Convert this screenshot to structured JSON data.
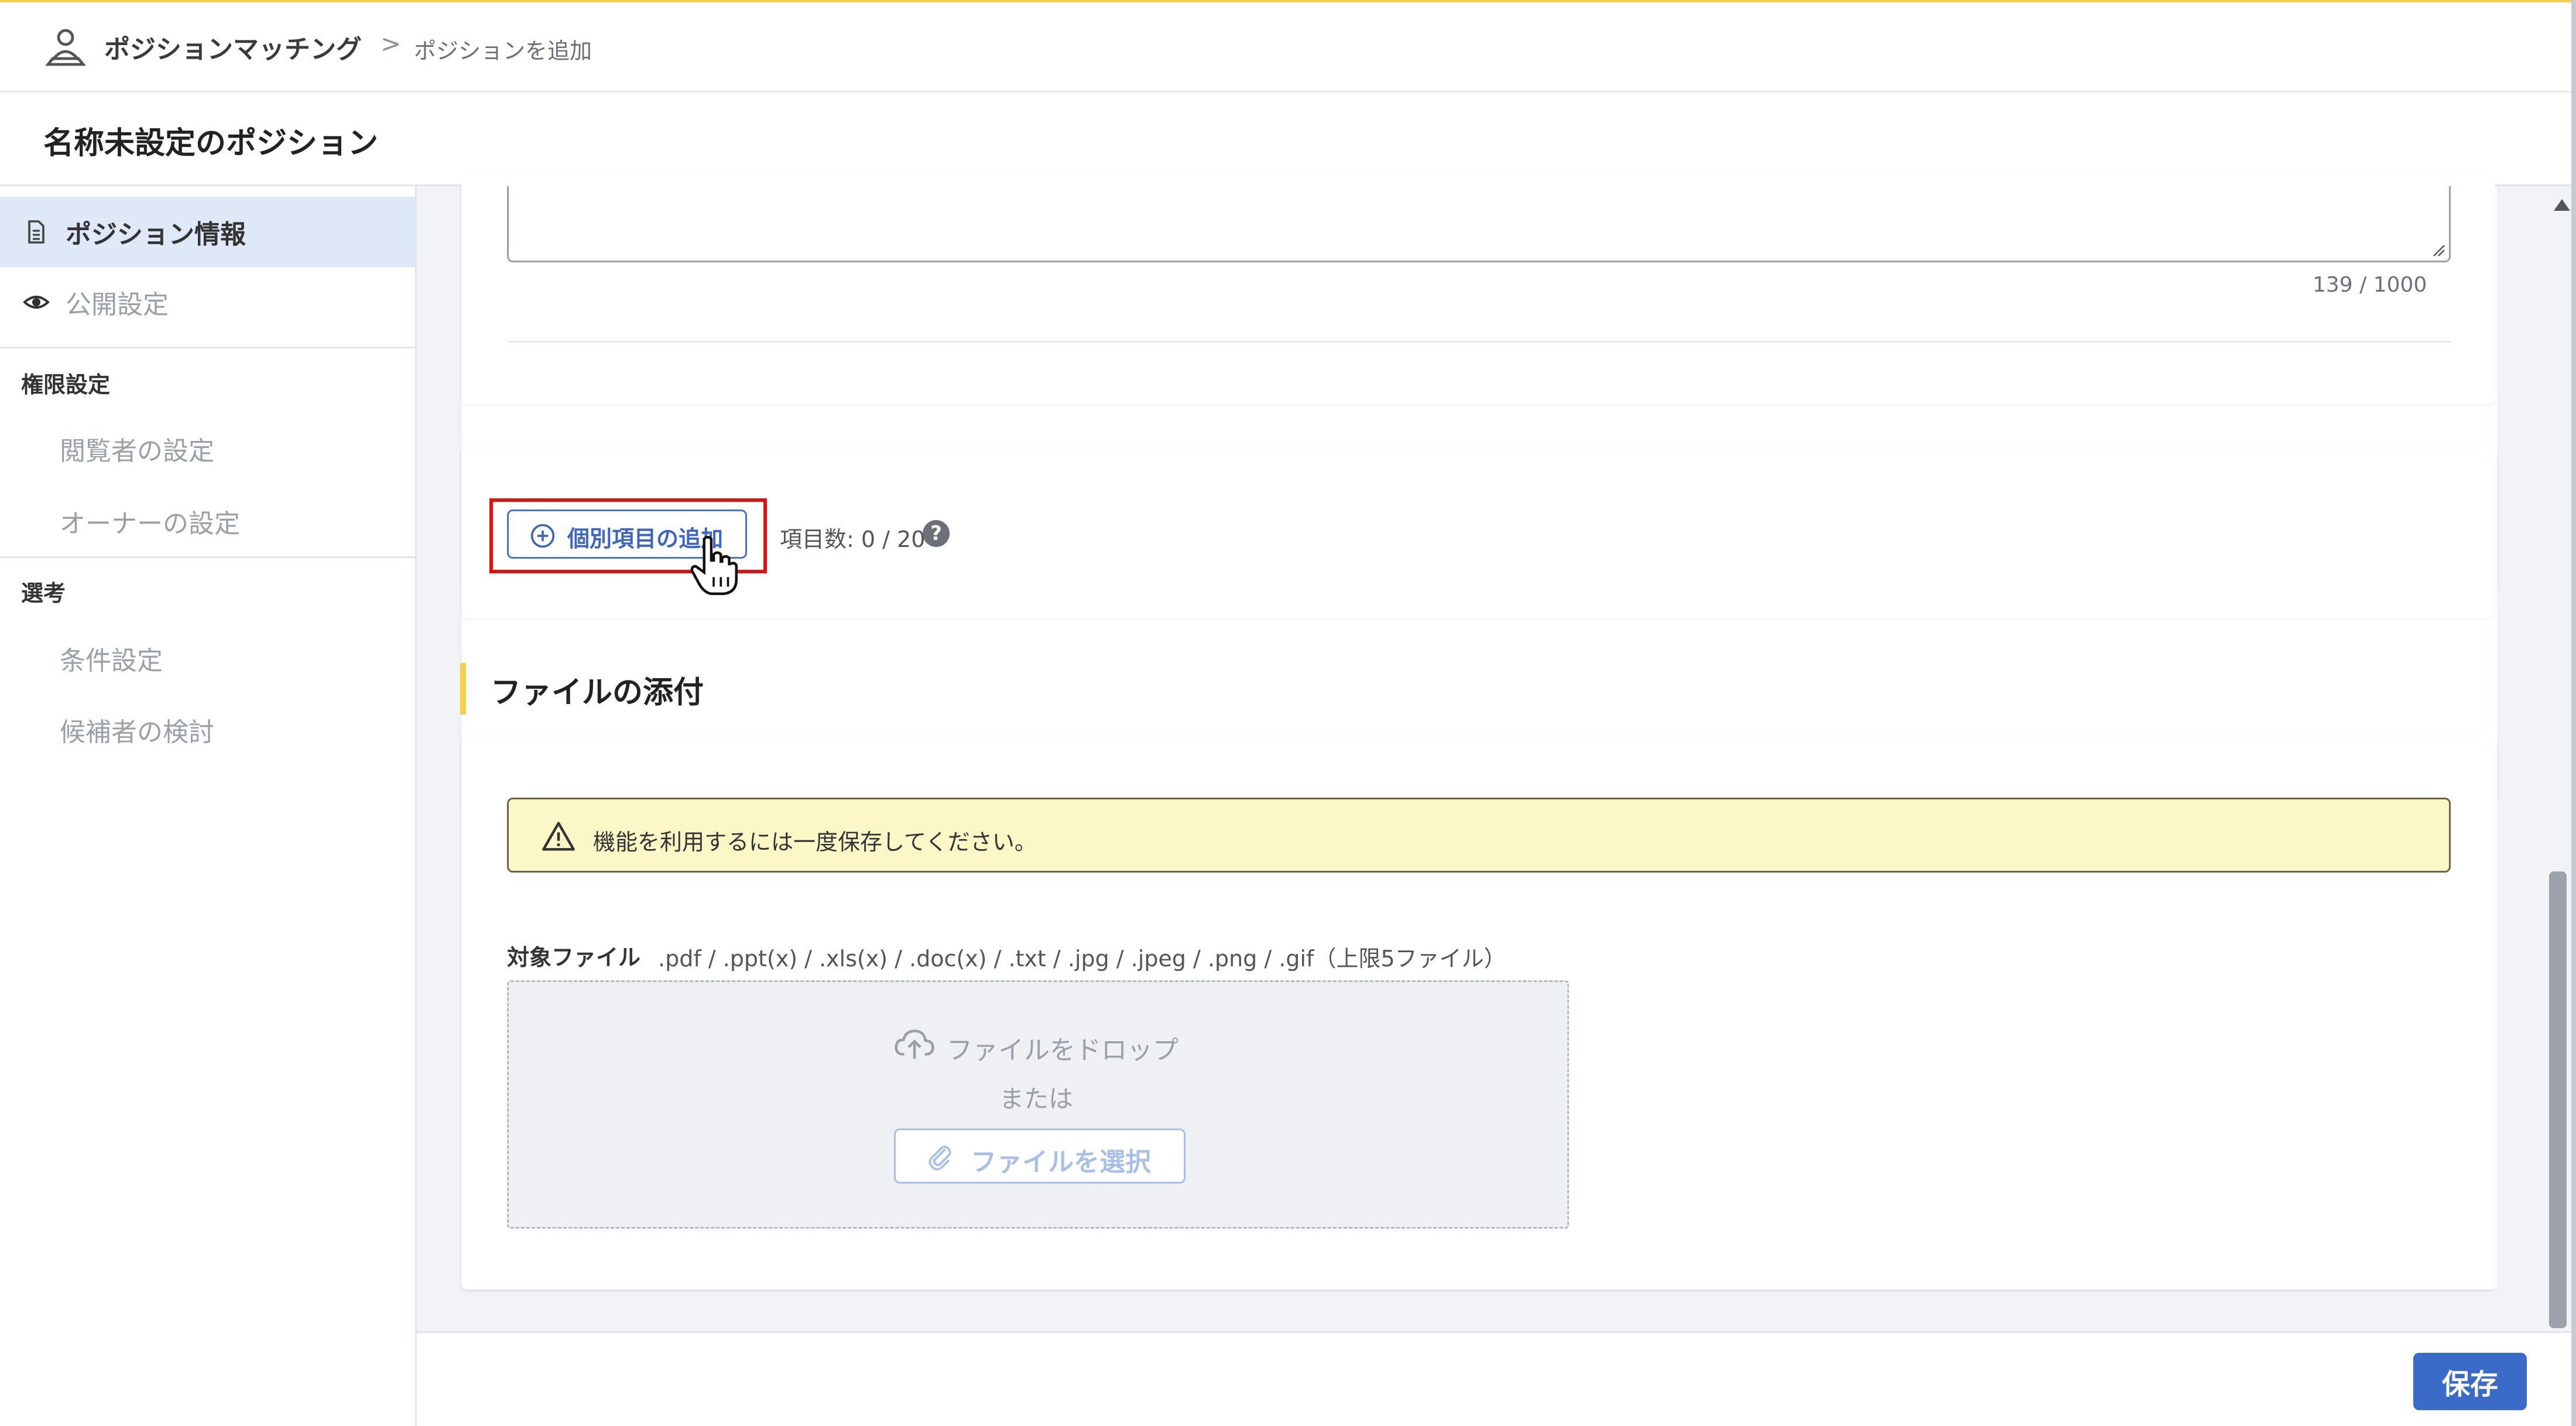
{
  "breadcrumb": {
    "app": "ポジションマッチング",
    "separator": ">",
    "current": "ポジションを追加"
  },
  "page": {
    "title": "名称未設定のポジション"
  },
  "sidebar": {
    "items": [
      {
        "label": "ポジション情報",
        "icon": "document-icon",
        "active": true
      },
      {
        "label": "公開設定",
        "icon": "eye-icon",
        "active": false
      }
    ],
    "sections": [
      {
        "heading": "権限設定",
        "items": [
          "閲覧者の設定",
          "オーナーの設定"
        ]
      },
      {
        "heading": "選考",
        "items": [
          "条件設定",
          "候補者の検討"
        ]
      }
    ]
  },
  "description": {
    "counter": "139 / 1000"
  },
  "custom_items": {
    "add_label": "個別項目の追加",
    "count_label": "項目数: 0 / 20",
    "help": "?"
  },
  "attachments": {
    "section_title": "ファイルの添付",
    "alert": "機能を利用するには一度保存してください。",
    "target_label": "対象ファイル",
    "target_extensions": ".pdf / .ppt(x) / .xls(x) / .doc(x) / .txt / .jpg / .jpeg / .png / .gif（上限5ファイル）",
    "drop_label": "ファイルをドロップ",
    "or_label": "または",
    "select_label": "ファイルを選択"
  },
  "footer": {
    "save_label": "保存"
  },
  "colors": {
    "accent": "#3a6bc9",
    "highlight": "#e01010",
    "section_bar": "#f2d04c",
    "alert_bg": "#fbf7c7"
  }
}
